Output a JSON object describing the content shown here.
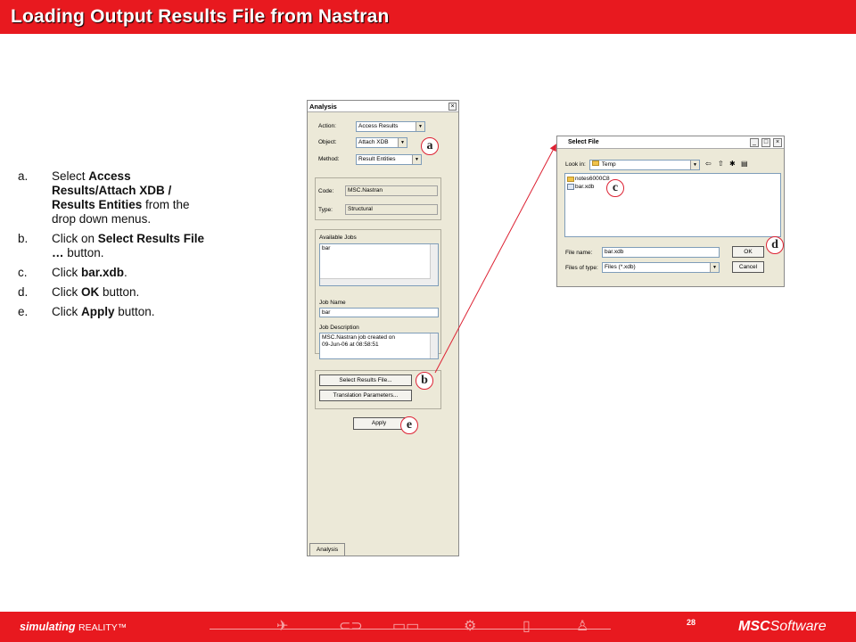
{
  "title": "Loading Output Results File from Nastran",
  "steps": [
    {
      "letter": "a.",
      "parts": [
        {
          "t": "Select ",
          "b": false
        },
        {
          "t": "Access Results/Attach XDB / Results Entities",
          "b": true
        },
        {
          "t": " from the drop down menus.",
          "b": false
        }
      ]
    },
    {
      "letter": "b.",
      "parts": [
        {
          "t": "Click on ",
          "b": false
        },
        {
          "t": "Select Results File …",
          "b": true
        },
        {
          "t": " button.",
          "b": false
        }
      ]
    },
    {
      "letter": "c.",
      "parts": [
        {
          "t": "Click ",
          "b": false
        },
        {
          "t": "bar.xdb",
          "b": true
        },
        {
          "t": ".",
          "b": false
        }
      ]
    },
    {
      "letter": "d.",
      "parts": [
        {
          "t": "Click ",
          "b": false
        },
        {
          "t": "OK",
          "b": true
        },
        {
          "t": " button.",
          "b": false
        }
      ]
    },
    {
      "letter": "e.",
      "parts": [
        {
          "t": "Click ",
          "b": false
        },
        {
          "t": "Apply",
          "b": true
        },
        {
          "t": " button.",
          "b": false
        }
      ]
    }
  ],
  "analysis": {
    "title": "Analysis",
    "action_label": "Action:",
    "action_value": "Access Results",
    "object_label": "Object:",
    "object_value": "Attach XDB",
    "method_label": "Method:",
    "method_value": "Result Entities",
    "code_label": "Code:",
    "code_value": "MSC.Nastran",
    "type_label": "Type:",
    "type_value": "Structural",
    "available_jobs_label": "Available Jobs",
    "available_jobs": [
      "bar"
    ],
    "job_name_label": "Job Name",
    "job_name_value": "bar",
    "job_desc_label": "Job Description",
    "job_desc_line1": "MSC.Nastran job created on",
    "job_desc_line2": "09-Jun-06 at 08:58:51",
    "select_results_btn": "Select Results File...",
    "translation_btn": "Translation Parameters...",
    "apply_btn": "Apply",
    "tab_label": "Analysis"
  },
  "select_file": {
    "title": "Select File",
    "look_in_label": "Look in:",
    "look_in_value": "Temp",
    "items": [
      {
        "name": "notes6000C8",
        "icon": "folder-icon"
      },
      {
        "name": "bar.xdb",
        "icon": "file-icon"
      }
    ],
    "file_name_label": "File name:",
    "file_name_value": "bar.xdb",
    "files_of_type_label": "Files of type:",
    "files_of_type_value": "Files (*.xdb)",
    "ok_btn": "OK",
    "cancel_btn": "Cancel"
  },
  "callouts": {
    "a": "a",
    "b": "b",
    "c": "c",
    "d": "d",
    "e": "e"
  },
  "footer": {
    "brand": "simulating",
    "reality": "REALITY™",
    "page_number": "28",
    "logo_msc": "MSC",
    "logo_software": "Software"
  },
  "colors": {
    "accent": "#e8191f",
    "callout_border": "#dd2233"
  }
}
